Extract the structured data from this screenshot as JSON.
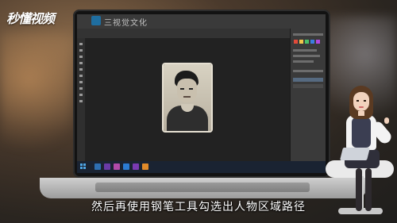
{
  "watermark": {
    "brand_text": "秒懂视频"
  },
  "photoshop": {
    "window_title": "三视觉文化",
    "taskbar_apps": [
      {
        "name": "file-explorer",
        "color": "#2e6fb2"
      },
      {
        "name": "app",
        "color": "#6a3aa7"
      },
      {
        "name": "app",
        "color": "#b24aa8"
      },
      {
        "name": "app",
        "color": "#2b7bd2"
      },
      {
        "name": "app",
        "color": "#7a3ab2"
      },
      {
        "name": "photoshop",
        "color": "#e08a2a"
      }
    ]
  },
  "subtitle": {
    "text": "然后再使用钢笔工具勾选出人物区域路径"
  },
  "colors": {
    "taskbar": "#1a2332",
    "canvas": "#222222",
    "panel": "#3a3a3a",
    "accent_blue": "#1f6ea0",
    "selected_layer": "#566a80"
  },
  "icons": {
    "start": "windows-start-icon",
    "ps_logo": "photoshop-logo-icon"
  }
}
